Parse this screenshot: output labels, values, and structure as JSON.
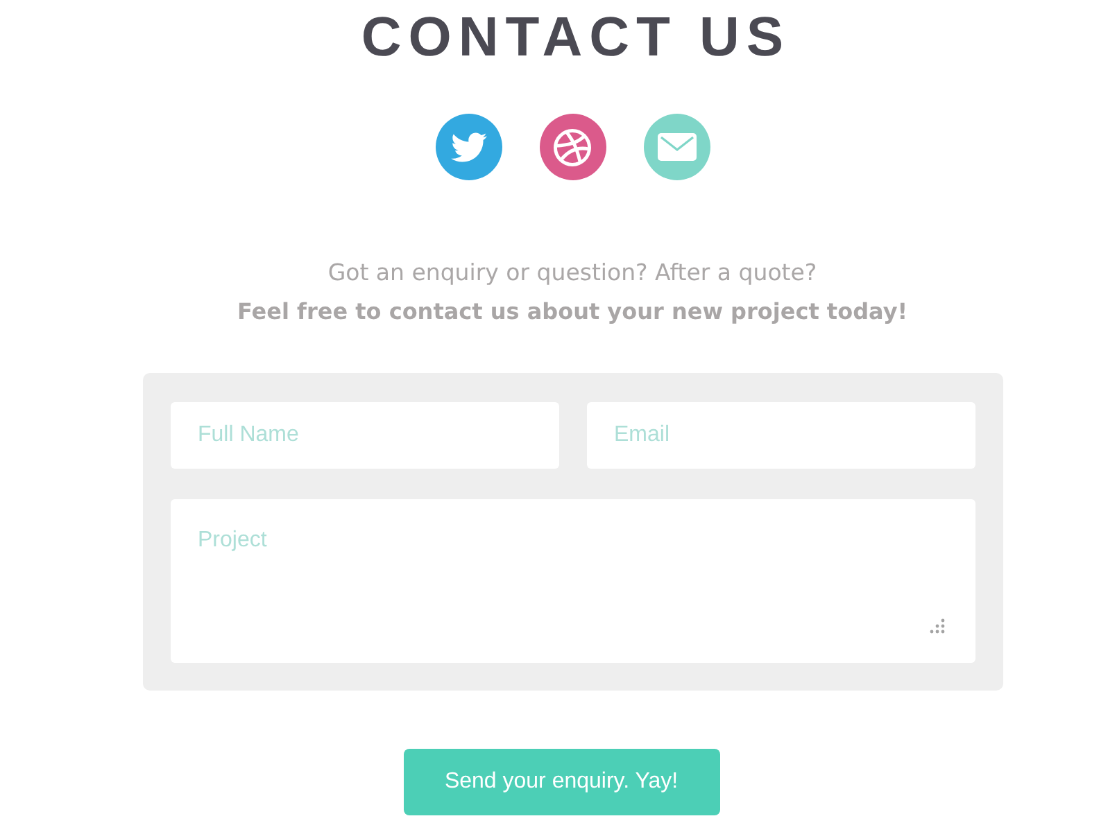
{
  "heading": {
    "title": "CONTACT US"
  },
  "social_links": [
    {
      "kind": "twitter",
      "color": "#33a9e0"
    },
    {
      "kind": "dribbble",
      "color": "#db5a8b"
    },
    {
      "kind": "email",
      "color": "#7fd6c8"
    }
  ],
  "intro": {
    "question": "Got an enquiry or question? After a quote?",
    "call_to_action": "Feel free to contact us about your new project today!"
  },
  "form": {
    "fields": [
      {
        "kind": "text",
        "placeholder": "Full Name"
      },
      {
        "kind": "email",
        "placeholder": "Email"
      },
      {
        "kind": "textarea",
        "placeholder": "Project"
      }
    ],
    "submit": {
      "label": "Send your enquiry. Yay!"
    }
  }
}
